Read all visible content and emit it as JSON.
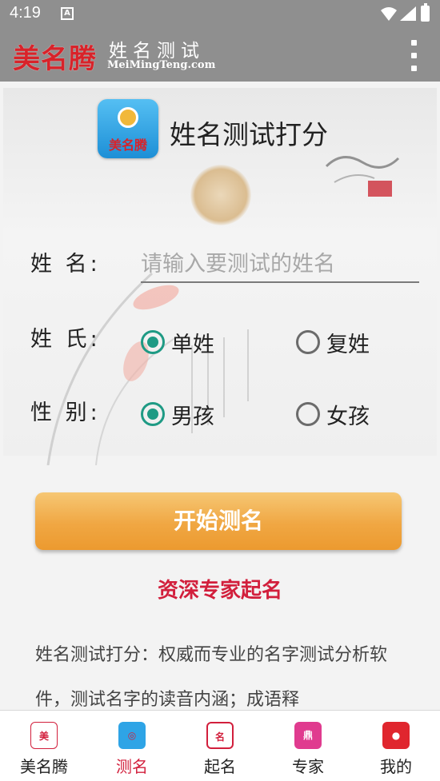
{
  "status_bar": {
    "time": "4:19",
    "notification": "A"
  },
  "app_bar": {
    "brand": "美名腾",
    "app_name": "姓名测试",
    "url": "MeiMingTeng.com"
  },
  "title": {
    "icon_caption": "美名腾",
    "text": "姓名测试打分"
  },
  "form": {
    "name_label": "姓 名:",
    "name_placeholder": "请输入要测试的姓名",
    "surname_label": "姓 氏:",
    "surname_options": [
      "单姓",
      "复姓"
    ],
    "surname_selected": "单姓",
    "gender_label": "性 别:",
    "gender_options": [
      "男孩",
      "女孩"
    ],
    "gender_selected": "男孩"
  },
  "start_button": "开始测名",
  "expert_link": "资深专家起名",
  "description": "姓名测试打分：权威而专业的名字测试分析软件，测试名字的读音内涵；成语释",
  "tabs": [
    {
      "label": "美名腾",
      "icon": "home-logo-icon"
    },
    {
      "label": "测名",
      "icon": "test-name-icon",
      "active": true
    },
    {
      "label": "起名",
      "icon": "give-name-icon"
    },
    {
      "label": "专家",
      "icon": "expert-icon"
    },
    {
      "label": "我的",
      "icon": "profile-icon"
    }
  ],
  "colors": {
    "accent": "#1e9a84",
    "brand_red": "#d21f3c",
    "button_orange": "#f0a743",
    "appbar": "#8f8f8f"
  }
}
